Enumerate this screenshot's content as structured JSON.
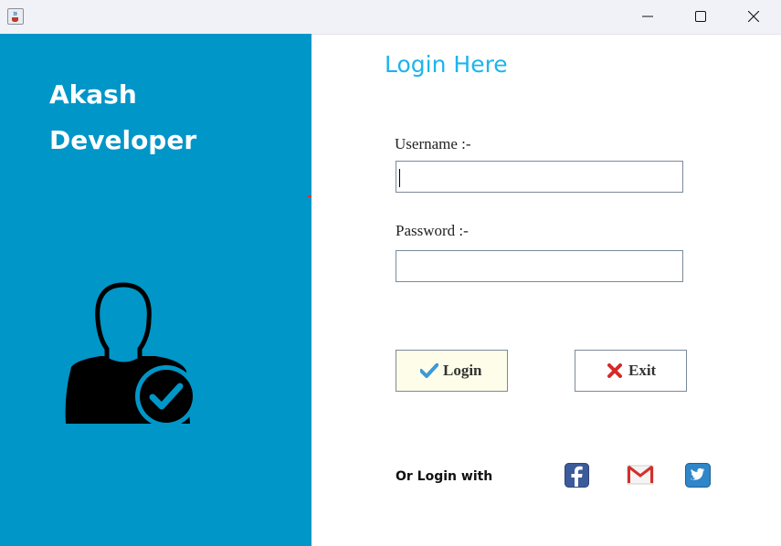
{
  "window": {
    "app_icon": "java-cup-icon"
  },
  "branding": {
    "line1": "Akash",
    "line2": "Developer",
    "panel_color": "#0096c8"
  },
  "login": {
    "title": "Login Here",
    "title_color": "#1eb4ec",
    "username_label": "Username :-",
    "username_value": "",
    "password_label": "Password :-",
    "password_value": "",
    "login_button": "Login",
    "exit_button": "Exit",
    "social_text": "Or Login with",
    "social_icons": [
      "facebook-icon",
      "gmail-icon",
      "twitter-icon"
    ]
  }
}
